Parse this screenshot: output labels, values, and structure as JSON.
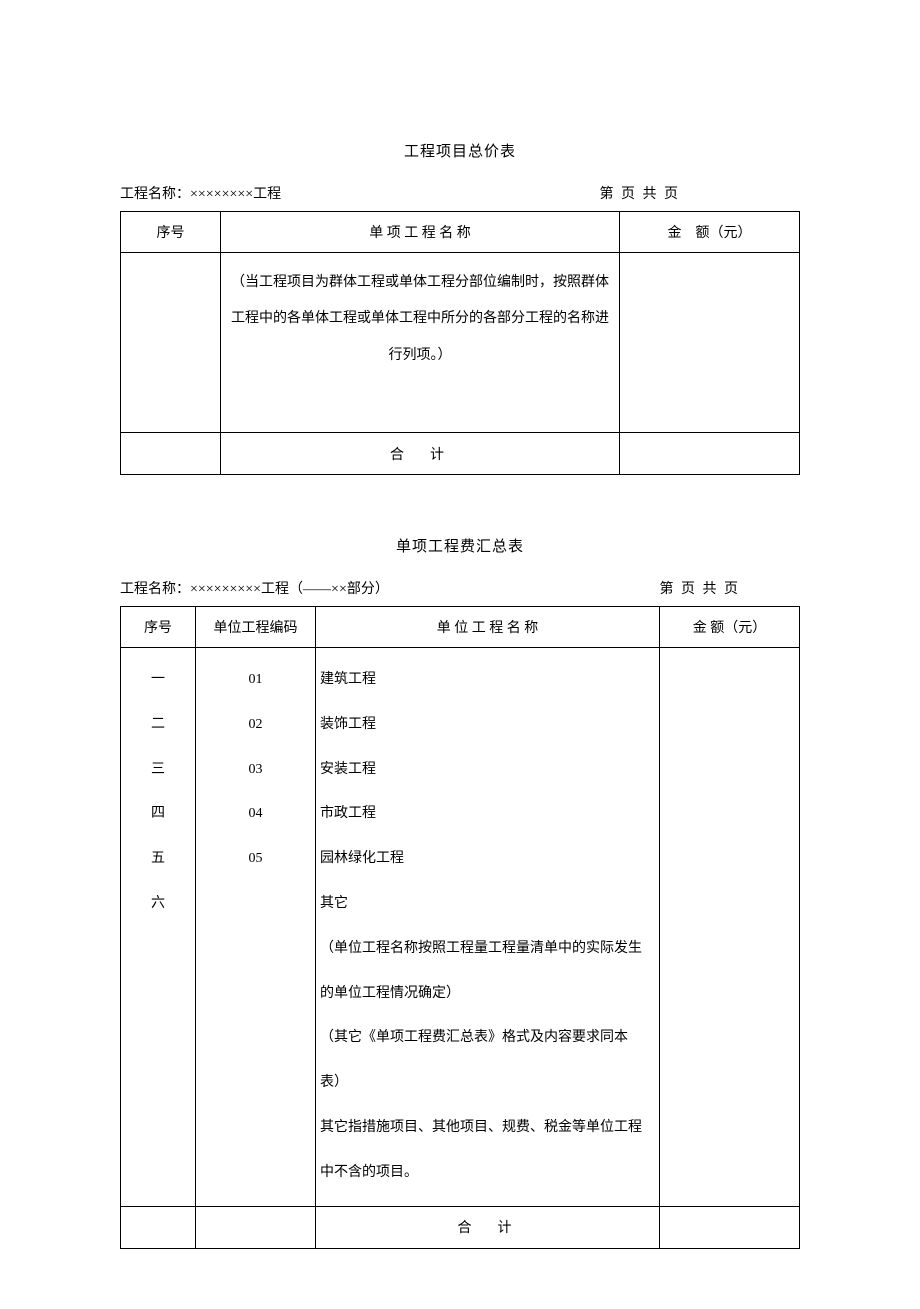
{
  "table1": {
    "title": "工程项目总价表",
    "meta_left": "工程名称：××××××××工程",
    "meta_right": "第 页 共 页",
    "headers": {
      "col1": "序号",
      "col2": "单 项 工 程 名 称",
      "col3": "金　额（元）"
    },
    "body_note": "（当工程项目为群体工程或单体工程分部位编制时，按照群体工程中的各单体工程或单体工程中所分的各部分工程的名称进行列项。）",
    "sum_label": "合　计"
  },
  "table2": {
    "title": "单项工程费汇总表",
    "meta_left": "工程名称：×××××××××工程（——××部分）",
    "meta_right": "第 页 共 页",
    "headers": {
      "col1": "序号",
      "col2": "单位工程编码",
      "col3": "单 位 工 程 名 称",
      "col4": "金 额（元）"
    },
    "indices": [
      "一",
      "二",
      "三",
      "四",
      "五",
      "六"
    ],
    "codes": [
      "01",
      "02",
      "03",
      "04",
      "05"
    ],
    "names_text": "建筑工程\n装饰工程\n安装工程\n市政工程\n园林绿化工程\n其它\n（单位工程名称按照工程量工程量清单中的实际发生的单位工程情况确定）\n（其它《单项工程费汇总表》格式及内容要求同本表）\n其它指措施项目、其他项目、规费、税金等单位工程中不含的项目。",
    "sum_label": "合　计"
  }
}
